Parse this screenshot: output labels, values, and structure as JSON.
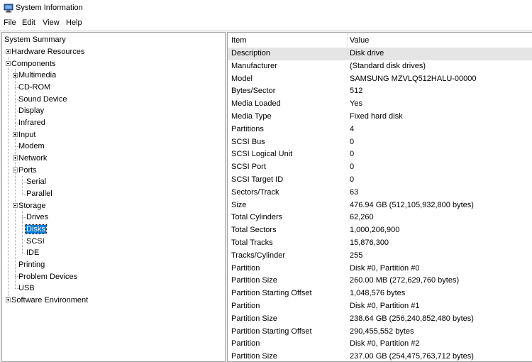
{
  "window": {
    "title": "System Information",
    "icon": "system-information-icon"
  },
  "menu": [
    "File",
    "Edit",
    "View",
    "Help"
  ],
  "tree": {
    "system_summary": "System Summary",
    "hardware_resources": "Hardware Resources",
    "components": "Components",
    "multimedia": "Multimedia",
    "cdrom": "CD-ROM",
    "sound_device": "Sound Device",
    "display": "Display",
    "infrared": "Infrared",
    "input": "Input",
    "modem": "Modem",
    "network": "Network",
    "ports": "Ports",
    "serial": "Serial",
    "parallel": "Parallel",
    "storage": "Storage",
    "drives": "Drives",
    "disks": "Disks",
    "scsi": "SCSI",
    "ide": "IDE",
    "printing": "Printing",
    "problem_devices": "Problem Devices",
    "usb": "USB",
    "software_environment": "Software Environment"
  },
  "list": {
    "headers": {
      "item": "Item",
      "value": "Value"
    },
    "rows": [
      {
        "item": "Description",
        "value": "Disk drive"
      },
      {
        "item": "Manufacturer",
        "value": "(Standard disk drives)"
      },
      {
        "item": "Model",
        "value": "SAMSUNG MZVLQ512HALU-00000"
      },
      {
        "item": "Bytes/Sector",
        "value": "512"
      },
      {
        "item": "Media Loaded",
        "value": "Yes"
      },
      {
        "item": "Media Type",
        "value": "Fixed hard disk"
      },
      {
        "item": "Partitions",
        "value": "4"
      },
      {
        "item": "SCSI Bus",
        "value": "0"
      },
      {
        "item": "SCSI Logical Unit",
        "value": "0"
      },
      {
        "item": "SCSI Port",
        "value": "0"
      },
      {
        "item": "SCSI Target ID",
        "value": "0"
      },
      {
        "item": "Sectors/Track",
        "value": "63"
      },
      {
        "item": "Size",
        "value": "476.94 GB (512,105,932,800 bytes)"
      },
      {
        "item": "Total Cylinders",
        "value": "62,260"
      },
      {
        "item": "Total Sectors",
        "value": "1,000,206,900"
      },
      {
        "item": "Total Tracks",
        "value": "15,876,300"
      },
      {
        "item": "Tracks/Cylinder",
        "value": "255"
      },
      {
        "item": "Partition",
        "value": "Disk #0, Partition #0"
      },
      {
        "item": "Partition Size",
        "value": "260.00 MB (272,629,760 bytes)"
      },
      {
        "item": "Partition Starting Offset",
        "value": "1,048,576 bytes"
      },
      {
        "item": "Partition",
        "value": "Disk #0, Partition #1"
      },
      {
        "item": "Partition Size",
        "value": "238.64 GB (256,240,852,480 bytes)"
      },
      {
        "item": "Partition Starting Offset",
        "value": "290,455,552 bytes"
      },
      {
        "item": "Partition",
        "value": "Disk #0, Partition #2"
      },
      {
        "item": "Partition Size",
        "value": "237.00 GB (254,475,763,712 bytes)"
      }
    ]
  },
  "colors": {
    "selection": "#0078d7",
    "row_highlight": "#e5e5e5"
  }
}
